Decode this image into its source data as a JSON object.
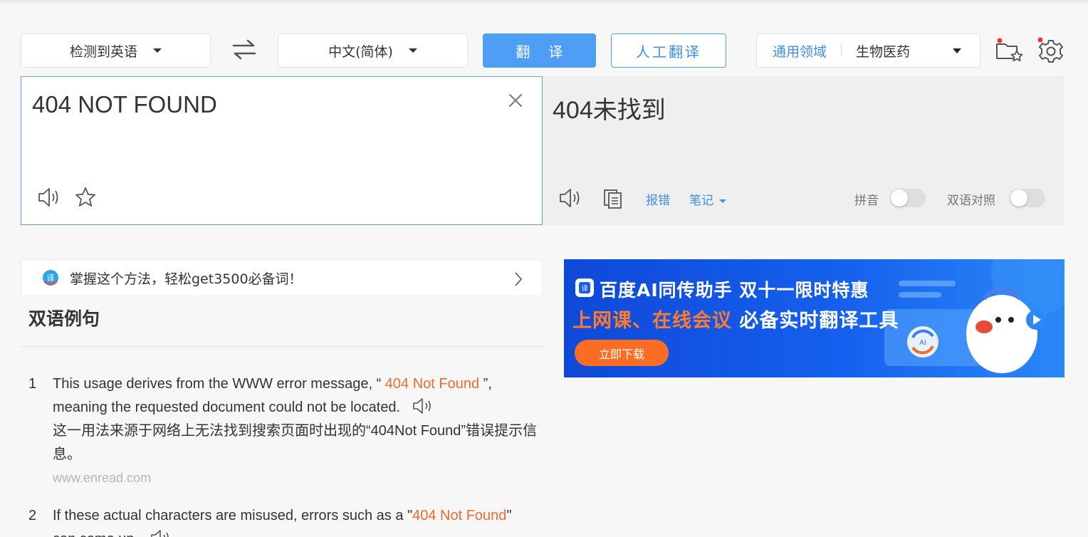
{
  "toolbar": {
    "source_lang": "检测到英语",
    "target_lang": "中文(简体)",
    "translate_label": "翻译",
    "human_translate_label": "人工翻译",
    "domain_general": "通用领域",
    "domain_selected": "生物医药"
  },
  "source": {
    "text": "404 NOT FOUND"
  },
  "result": {
    "text": "404未找到",
    "report_error": "报错",
    "notes": "笔记",
    "pinyin_label": "拼音",
    "pinyin_on": false,
    "bilingual_label": "双语对照",
    "bilingual_on": false
  },
  "tip": {
    "text": "掌握这个方法，轻松get3500必备词！"
  },
  "examples_title": "双语例句",
  "examples": [
    {
      "num": "1",
      "en_before": "This usage derives from the WWW error message, “ ",
      "en_highlight": "404 Not Found",
      "en_after": " ”,",
      "en_line2": "meaning the requested document could not be located.",
      "zh": "这一用法来源于网络上无法找到搜索页面时出现的“404Not Found”错误提示信息。",
      "source": "www.enread.com"
    },
    {
      "num": "2",
      "en_before": "If these actual characters are misused, errors such as a \"",
      "en_highlight": "404 Not Found",
      "en_after": "\"",
      "en_line2": "can come up."
    }
  ],
  "banner": {
    "title": "百度AI同传助手 双十一限时特惠",
    "subtitle_orange": "上网课、在线会议",
    "subtitle_white": " 必备实时翻译工具",
    "cta": "立即下载"
  },
  "colors": {
    "accent_blue": "#4e9ef5",
    "link_blue": "#3f8ef0",
    "highlight_orange": "#f26b2a",
    "banner_blue": "#1560ee"
  }
}
